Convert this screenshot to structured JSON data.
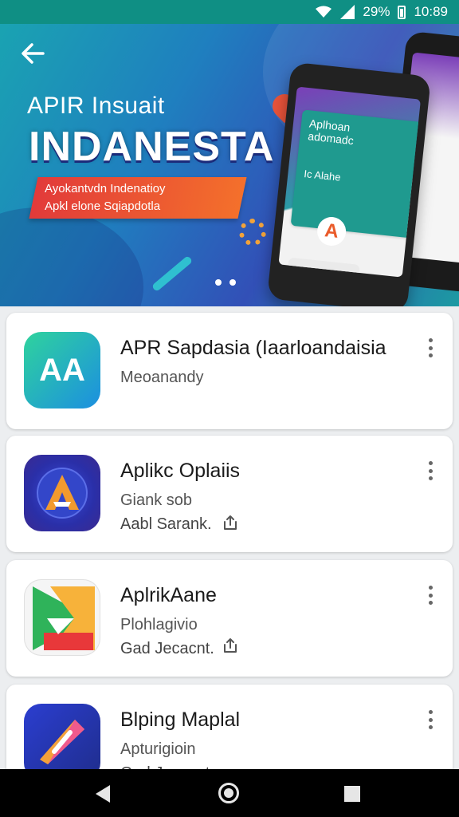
{
  "status_bar": {
    "battery_text": "29%",
    "time": "10:89",
    "icons": [
      "wifi-icon",
      "signal-icon",
      "battery-icon"
    ]
  },
  "banner": {
    "subtitle": "APIR Insuait",
    "title": "INDANESTA",
    "ribbon_line1": "Ayokantvdn Indenatioy",
    "ribbon_line2": "Apkl elone Sqiapdotla",
    "phone_screen_text1": "Aplhoan",
    "phone_screen_text2": "adomadc",
    "phone_screen_text3": "Ic Alahe",
    "phone_logo_letter": "A",
    "page_count": 2,
    "colors": {
      "accent": "#2fb5c0",
      "ribbon": "#e8443a"
    }
  },
  "apps": [
    {
      "name": "APR Sapdasia (Iaarloandaisia",
      "line1": "Meoanandy",
      "line2": "",
      "icon": "aa-logo-icon",
      "icon_text": "AA",
      "icon_colors": [
        "#2fd39d",
        "#1c8fe0"
      ]
    },
    {
      "name": "Aplikc Oplaiis",
      "line1": "Giank sob",
      "line2": "Aabl Sarank.",
      "icon": "a-triangle-logo-icon",
      "icon_text": "A",
      "icon_colors": [
        "#2a36c7",
        "#4b2c9e"
      ]
    },
    {
      "name": "AplrikАane",
      "line1": "Plohlagivio",
      "line2": "Gad Jecacnt.",
      "icon": "triangle-logo-icon",
      "icon_text": "",
      "icon_colors": [
        "#f7d43a",
        "#e93f3a"
      ]
    },
    {
      "name": "Blping Maplal",
      "line1": "Apturigioin",
      "line2": "Gad Jecacnt.",
      "icon": "compass-logo-icon",
      "icon_text": "",
      "icon_colors": [
        "#2b3ed0",
        "#f0578d"
      ]
    }
  ],
  "nav": {
    "icons": [
      "back-triangle-icon",
      "home-circle-icon",
      "recents-square-icon"
    ]
  }
}
